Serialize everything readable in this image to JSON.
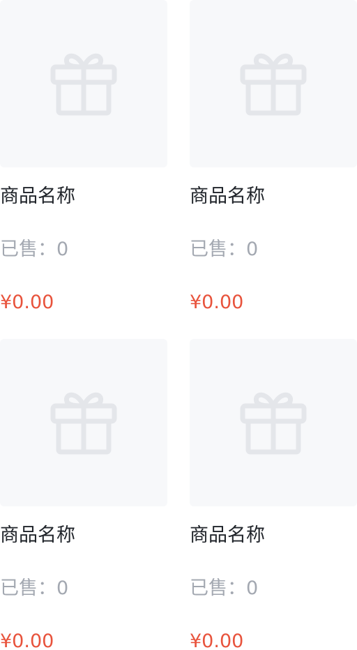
{
  "products": [
    {
      "name": "商品名称",
      "sold": "已售：0",
      "price": "¥0.00",
      "image_icon": "gift-icon"
    },
    {
      "name": "商品名称",
      "sold": "已售：0",
      "price": "¥0.00",
      "image_icon": "gift-icon"
    },
    {
      "name": "商品名称",
      "sold": "已售：0",
      "price": "¥0.00",
      "image_icon": "gift-icon"
    },
    {
      "name": "商品名称",
      "sold": "已售：0",
      "price": "¥0.00",
      "image_icon": "gift-icon"
    }
  ],
  "colors": {
    "placeholder_bg": "#f7f8fa",
    "placeholder_icon": "#e4e6ea",
    "name_text": "#1f2329",
    "sold_text": "#a3a8b1",
    "price_text": "#e8533c"
  }
}
